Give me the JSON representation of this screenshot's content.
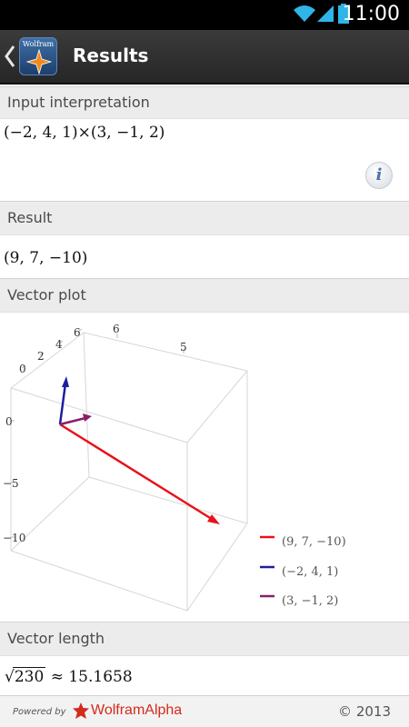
{
  "status_bar": {
    "time": "11:00"
  },
  "action_bar": {
    "title": "Results",
    "logo_text": "Wolfram"
  },
  "pods": {
    "input": {
      "title": "Input interpretation",
      "expression": "(−2, 4, 1)×(3, −1, 2)"
    },
    "result": {
      "title": "Result",
      "value": "(9, 7, −10)"
    },
    "vector_plot": {
      "title": "Vector plot"
    },
    "vector_length": {
      "title": "Vector length",
      "radicand": "230",
      "approx": "≈ 15.1658"
    }
  },
  "chart_data": {
    "type": "3d-vector",
    "axis_ticks": {
      "axis1": [
        "0",
        "2",
        "4",
        "6"
      ],
      "axis2": [
        "5"
      ],
      "vertical": [
        "0",
        "−5",
        "−10"
      ]
    },
    "series": [
      {
        "name": "(9, 7, −10)",
        "vector": [
          9,
          7,
          -10
        ],
        "color": "#e8121a"
      },
      {
        "name": "(−2, 4, 1)",
        "vector": [
          -2,
          4,
          1
        ],
        "color": "#1e1ea0"
      },
      {
        "name": "(3, −1, 2)",
        "vector": [
          3,
          -1,
          2
        ],
        "color": "#8a1e6a"
      }
    ]
  },
  "footer": {
    "powered_by": "Powered by",
    "brand": "WolframAlpha",
    "copyright": "© 2013"
  },
  "colors": {
    "action_bar": "#2e2e2e",
    "pod_header": "#ececec",
    "brand_red": "#d42a1c"
  }
}
